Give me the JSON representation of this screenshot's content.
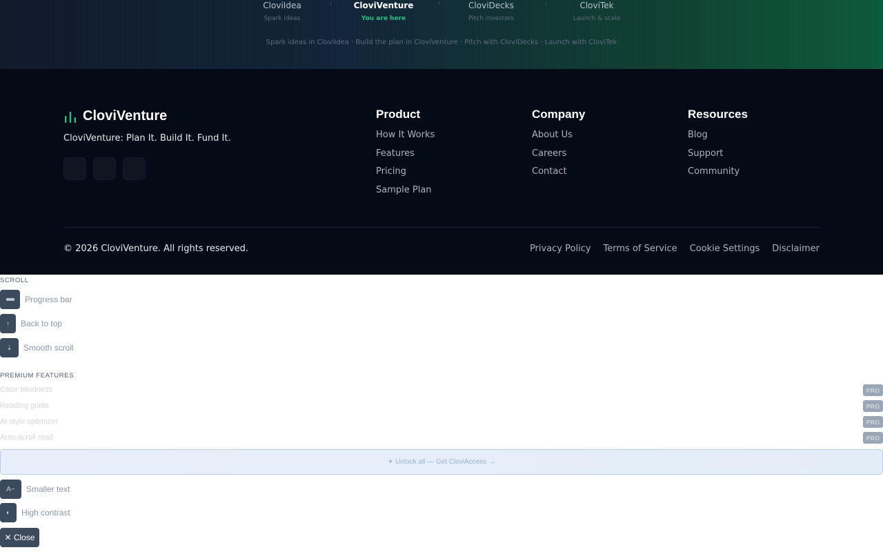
{
  "journey": {
    "steps": [
      {
        "name": "CloviIdea",
        "sub": "Spark ideas"
      },
      {
        "name": "CloviVenture",
        "sub": "You are here"
      },
      {
        "name": "CloviDecks",
        "sub": "Pitch investors"
      },
      {
        "name": "CloviTek",
        "sub": "Launch & scale"
      }
    ],
    "tagline": "Spark ideas in CloviIdea · Build the plan in CloviVenture · Pitch with CloviDecks · Launch with CloviTek"
  },
  "footer": {
    "brand_name": "CloviVenture",
    "brand_icon": "bar-chart-icon",
    "slogan": "CloviVenture: Plan It. Build It. Fund It.",
    "columns": [
      {
        "title": "Product",
        "links": [
          "How It Works",
          "Features",
          "Pricing",
          "Sample Plan"
        ]
      },
      {
        "title": "Company",
        "links": [
          "About Us",
          "Careers",
          "Contact"
        ]
      },
      {
        "title": "Resources",
        "links": [
          "Blog",
          "Support",
          "Community"
        ]
      }
    ],
    "copyright": "© 2026 CloviVenture. All rights reserved.",
    "legal": [
      "Privacy Policy",
      "Terms of Service",
      "Cookie Settings",
      "Disclaimer"
    ]
  },
  "panel": {
    "scroll_title": "SCROLL",
    "scroll_tools": [
      {
        "glyph": "",
        "label": "Progress bar",
        "icon": "progress-bar-icon"
      },
      {
        "glyph": "↑",
        "label": "Back to top",
        "icon": "arrow-up-icon"
      },
      {
        "glyph": "⇣",
        "label": "Smooth scroll",
        "icon": "smooth-scroll-icon"
      }
    ],
    "premium_title": "PREMIUM FEATURES",
    "premium_features": [
      {
        "label": "Color blindness",
        "badge": "PRO"
      },
      {
        "label": "Reading guide",
        "badge": "PRO"
      },
      {
        "label": "AI style optimizer",
        "badge": "PRO"
      },
      {
        "label": "Auto-scroll read",
        "badge": "PRO"
      }
    ],
    "unlock_label": "✦ Unlock all — Get CloviAccess →",
    "text_tools": [
      {
        "glyph": "A−",
        "label": "Smaller text",
        "icon": "text-smaller-icon"
      },
      {
        "glyph": "◐",
        "label": "High contrast",
        "icon": "contrast-icon"
      }
    ],
    "close_label": "✕ Close"
  },
  "colors": {
    "accent_green": "#2fbf85",
    "footer_bg": "#050b16",
    "tool_button": "#3c4a5e"
  }
}
